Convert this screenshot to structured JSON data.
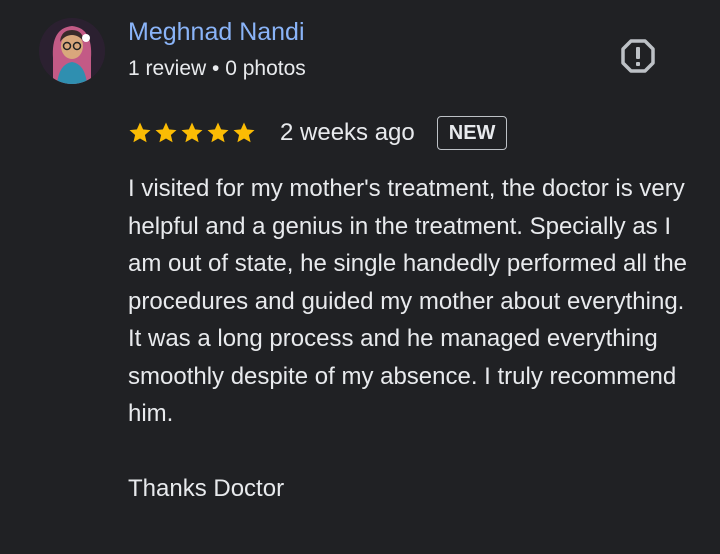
{
  "review": {
    "author": {
      "name": "Meghnad Nandi",
      "meta": "1 review • 0 photos",
      "avatar_icon": "user-avatar-icon"
    },
    "report_icon": "report-alert-icon",
    "rating": {
      "stars": 5,
      "max_stars": 5,
      "star_color": "#fbbc04"
    },
    "time_ago": "2 weeks ago",
    "badge": "NEW",
    "paragraphs": [
      "I visited for my mother's treatment, the doctor is very helpful and a genius in the treatment. Specially as I am out of state, he single handedly performed all the procedures and guided my mother about everything. It was a long process and he managed everything smoothly despite of my absence. I truly recommend him.",
      "Thanks Doctor"
    ]
  },
  "colors": {
    "background": "#202124",
    "author_name": "#8ab4f8",
    "text": "#e8eaed",
    "star": "#fbbc04"
  }
}
